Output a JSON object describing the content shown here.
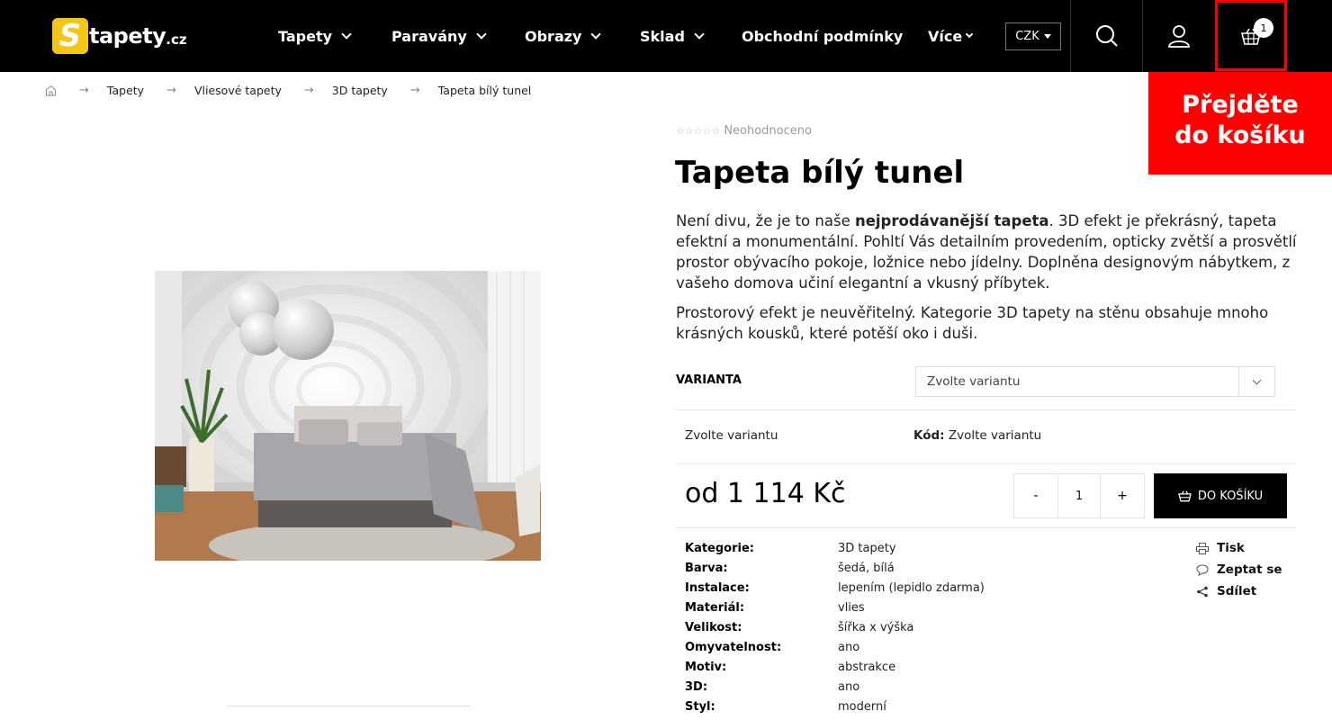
{
  "header": {
    "logo": {
      "letter": "S",
      "text": "tapety",
      "tld": ".cz"
    },
    "nav": [
      {
        "label": "Tapety"
      },
      {
        "label": "Paravány"
      },
      {
        "label": "Obrazy"
      },
      {
        "label": "Sklad"
      },
      {
        "label": "Obchodní podmínky"
      },
      {
        "label": "Více"
      }
    ],
    "currency": "CZK",
    "cart_count": "1",
    "icons": [
      "search-icon",
      "user-icon",
      "cart-icon"
    ]
  },
  "promo": {
    "line1": "Přejděte",
    "line2": "do košíku"
  },
  "breadcrumb": {
    "home_icon": "home-icon",
    "items": [
      "Tapety",
      "Vliesové tapety",
      "3D tapety",
      "Tapeta bílý tunel"
    ]
  },
  "product": {
    "rating_text": "Neohodnoceno",
    "title": "Tapeta bílý tunel",
    "desc1_pre": "Není divu, že je to naše ",
    "desc1_bold": "nejprodávanější tapeta",
    "desc1_post": ". 3D efekt je překrásný, tapeta efektní a monumentální. Pohltí Vás detailním provedením, opticky zvětší a prosvětlí prostor obývacího pokoje, ložnice nebo jídelny. Doplněna designovým nábytkem, z vašeho domova učiní elegantní a vkusný příbytek.",
    "desc2": "Prostorový efekt je neuvěřitelný. Kategorie 3D tapety na stěnu obsahuje mnoho krásných kousků, které potěší oko i duši.",
    "variant_label": "VARIANTA",
    "variant_placeholder": "Zvolte variantu",
    "selected_variant": "Zvolte variantu",
    "code_label": "Kód:",
    "code_value": "Zvolte variantu",
    "price": "od 1 114 Kč",
    "qty_minus": "-",
    "qty_value": "1",
    "qty_plus": "+",
    "add_to_cart": "DO KOŠÍKU",
    "specs": [
      {
        "key": "Kategorie:",
        "value": "3D tapety"
      },
      {
        "key": "Barva:",
        "value": "šedá, bílá"
      },
      {
        "key": "Instalace:",
        "value": "lepením (lepidlo zdarma)"
      },
      {
        "key": "Materiál:",
        "value": "vlies"
      },
      {
        "key": "Velikost:",
        "value": "šířka x výška"
      },
      {
        "key": "Omyvatelnost:",
        "value": "ano"
      },
      {
        "key": "Motiv:",
        "value": "abstrakce"
      },
      {
        "key": "3D:",
        "value": "ano"
      },
      {
        "key": "Styl:",
        "value": "moderní"
      }
    ],
    "actions": [
      "Tisk",
      "Zeptat se",
      "Sdílet"
    ]
  },
  "colors": {
    "header_bg": "#000000",
    "promo_red": "#ff0000",
    "logo_yellow": "#f5c518"
  }
}
